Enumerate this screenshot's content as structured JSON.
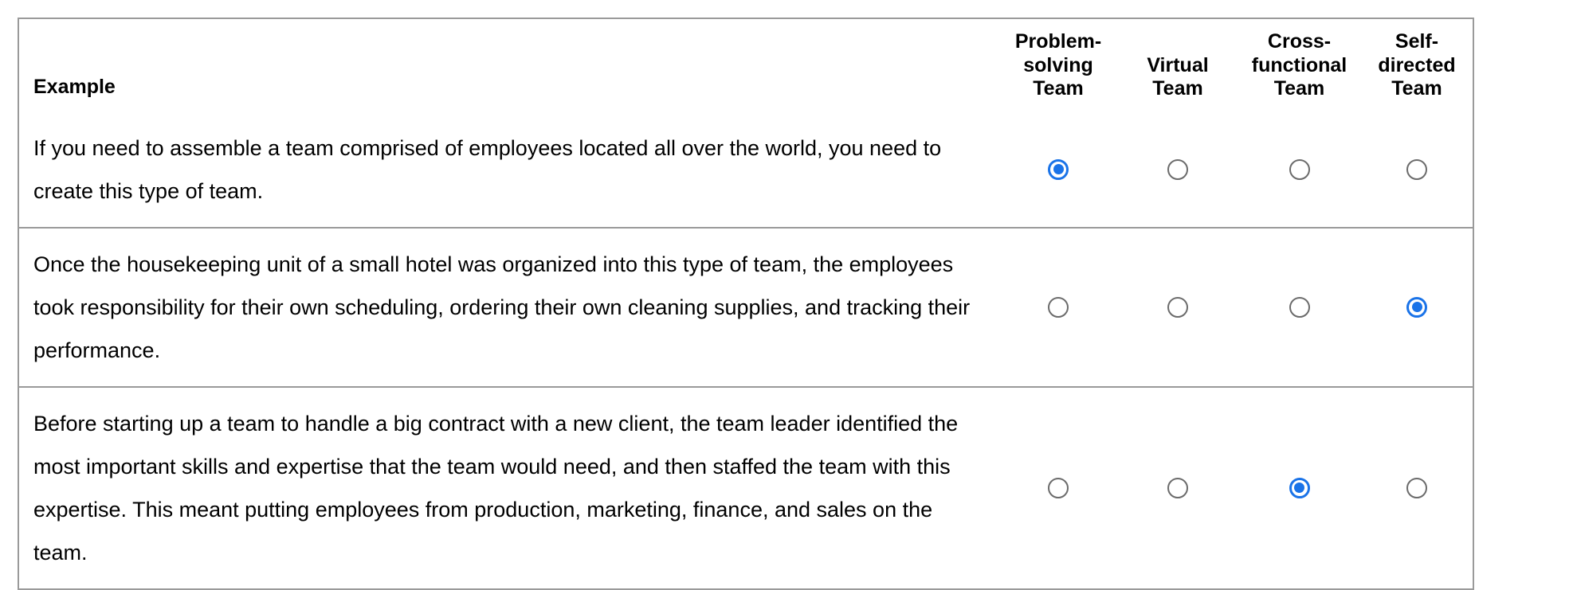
{
  "table": {
    "first_column_header": "Example",
    "option_headers": [
      "Problem-\nsolving\nTeam",
      "Virtual\nTeam",
      "Cross-\nfunctional\nTeam",
      "Self-\ndirected\nTeam"
    ],
    "option_headers_flat": [
      "Problem-solving Team",
      "Virtual Team",
      "Cross-functional Team",
      "Self-directed Team"
    ],
    "rows": [
      {
        "example": "If you need to assemble a team comprised of employees located all over the world, you need to create this type of team.",
        "selected_index": 0,
        "selected_label": "Problem-solving Team"
      },
      {
        "example": "Once the housekeeping unit of a small hotel was organized into this type of team, the employees took responsibility for their own scheduling, ordering their own cleaning supplies, and tracking their performance.",
        "selected_index": 3,
        "selected_label": "Self-directed Team"
      },
      {
        "example": "Before starting up a team to handle a big contract with a new client, the team leader identified the most important skills and expertise that the team would need, and then staffed the team with this expertise. This meant putting employees from production, marketing, finance, and sales on the team.",
        "selected_index": 2,
        "selected_label": "Cross-functional Team"
      }
    ]
  },
  "colors": {
    "selected_radio": "#1a73e8",
    "unselected_radio_border": "#6b6b6b",
    "table_border": "#9a9a9a",
    "text": "#000000",
    "background": "#ffffff"
  }
}
